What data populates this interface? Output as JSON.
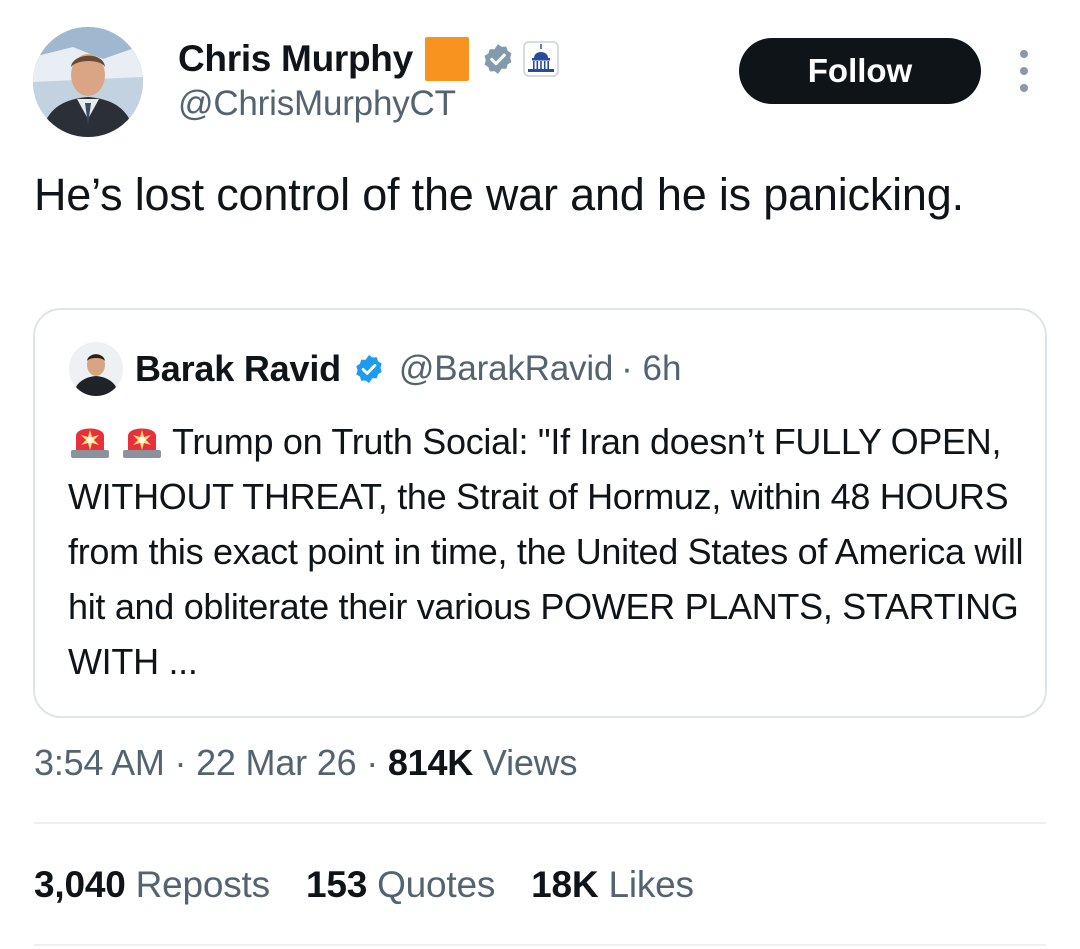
{
  "author": {
    "display_name": "Chris Murphy",
    "handle": "@ChrisMurphyCT",
    "label_color": "#f7931e",
    "verified_badge_color": "#829aab"
  },
  "actions": {
    "follow_label": "Follow"
  },
  "tweet": {
    "text": "He’s lost control of the war and he is panicking."
  },
  "quoted_tweet": {
    "display_name": "Barak Ravid",
    "handle": "@BarakRavid",
    "time": "· 6h",
    "verified_badge_color": "#1d9bf0",
    "text": "Trump on Truth Social: \"If Iran doesn’t FULLY OPEN, WITHOUT THREAT, the Strait of Hormuz, within 48 HOURS from this exact point in time, the United States of America will hit and obliterate their various POWER PLANTS, STARTING WITH ...",
    "prefix_icons": [
      "siren-icon",
      "siren-icon"
    ]
  },
  "meta": {
    "time": "3:54 AM",
    "sep1": "·",
    "date": "22 Mar 26",
    "sep2": "·",
    "views_count": "814K",
    "views_label": "Views"
  },
  "stats": {
    "reposts_count": "3,040",
    "reposts_label": "Reposts",
    "quotes_count": "153",
    "quotes_label": "Quotes",
    "likes_count": "18K",
    "likes_label": "Likes"
  }
}
